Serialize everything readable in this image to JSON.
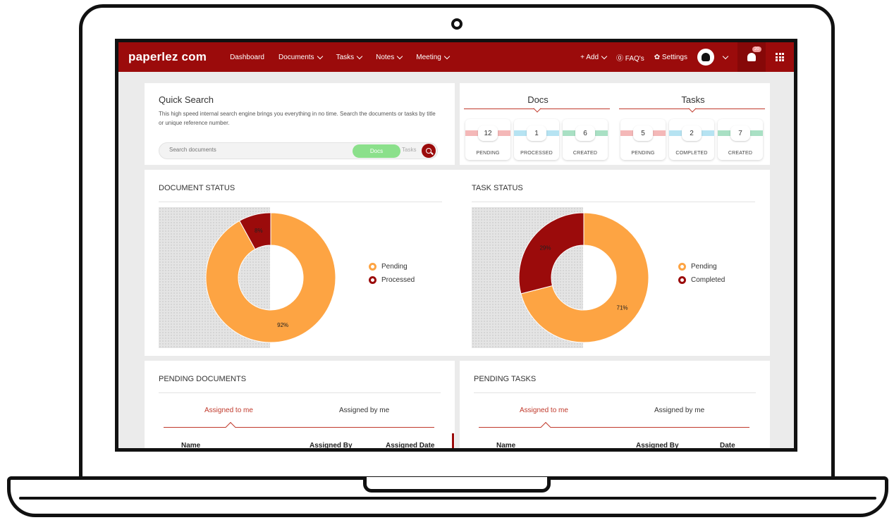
{
  "app": {
    "logo": "paperlez com"
  },
  "nav": {
    "items": [
      {
        "label": "Dashboard",
        "dropdown": false
      },
      {
        "label": "Documents",
        "dropdown": true
      },
      {
        "label": "Tasks",
        "dropdown": true
      },
      {
        "label": "Notes",
        "dropdown": true
      },
      {
        "label": "Meeting",
        "dropdown": true
      }
    ],
    "add_label": "+ Add",
    "faq_label": "⓪ FAQ's",
    "settings_label": "✿ Settings",
    "notification_count": "20"
  },
  "quick_search": {
    "title": "Quick Search",
    "description": "This high speed internal search engine brings you everything in no time. Search the documents or tasks by title or unique reference number.",
    "placeholder": "Search documents",
    "docs_toggle": "Docs",
    "tasks_toggle": "Tasks"
  },
  "stats": {
    "docs": {
      "title": "Docs",
      "items": [
        {
          "value": "12",
          "label": "PENDING",
          "color": "#f4b8b8"
        },
        {
          "value": "1",
          "label": "PROCESSED",
          "color": "#b6e3f2"
        },
        {
          "value": "6",
          "label": "CREATED",
          "color": "#a9e0c4"
        }
      ]
    },
    "tasks": {
      "title": "Tasks",
      "items": [
        {
          "value": "5",
          "label": "PENDING",
          "color": "#f4b8b8"
        },
        {
          "value": "2",
          "label": "COMPLETED",
          "color": "#b6e3f2"
        },
        {
          "value": "7",
          "label": "CREATED",
          "color": "#a9e0c4"
        }
      ]
    }
  },
  "document_status": {
    "title": "DOCUMENT STATUS",
    "chart_data": {
      "type": "pie",
      "donut": true,
      "categories": [
        "Pending",
        "Processed"
      ],
      "values": [
        92,
        8
      ],
      "value_labels": [
        "92%",
        "8%"
      ],
      "colors": [
        "#fda443",
        "#9b0b0b"
      ],
      "legend": [
        "Pending",
        "Processed"
      ],
      "legend_position": "right"
    }
  },
  "task_status": {
    "title": "TASK STATUS",
    "chart_data": {
      "type": "pie",
      "donut": true,
      "categories": [
        "Pending",
        "Completed"
      ],
      "values": [
        71,
        29
      ],
      "value_labels": [
        "71%",
        "29%"
      ],
      "colors": [
        "#fda443",
        "#9b0b0b"
      ],
      "legend": [
        "Pending",
        "Completed"
      ],
      "legend_position": "right"
    }
  },
  "pending_documents": {
    "title": "PENDING DOCUMENTS",
    "tabs": [
      "Assigned to me",
      "Assigned by me"
    ],
    "columns": [
      "Name",
      "Assigned By",
      "Assigned Date"
    ]
  },
  "pending_tasks": {
    "title": "PENDING TASKS",
    "tabs": [
      "Assigned to me",
      "Assigned by me"
    ],
    "columns": [
      "Name",
      "Assigned By",
      "Date"
    ]
  },
  "colors": {
    "brand": "#9b0b0b",
    "accent_orange": "#fda443",
    "docs_toggle_green": "#8be08b"
  }
}
